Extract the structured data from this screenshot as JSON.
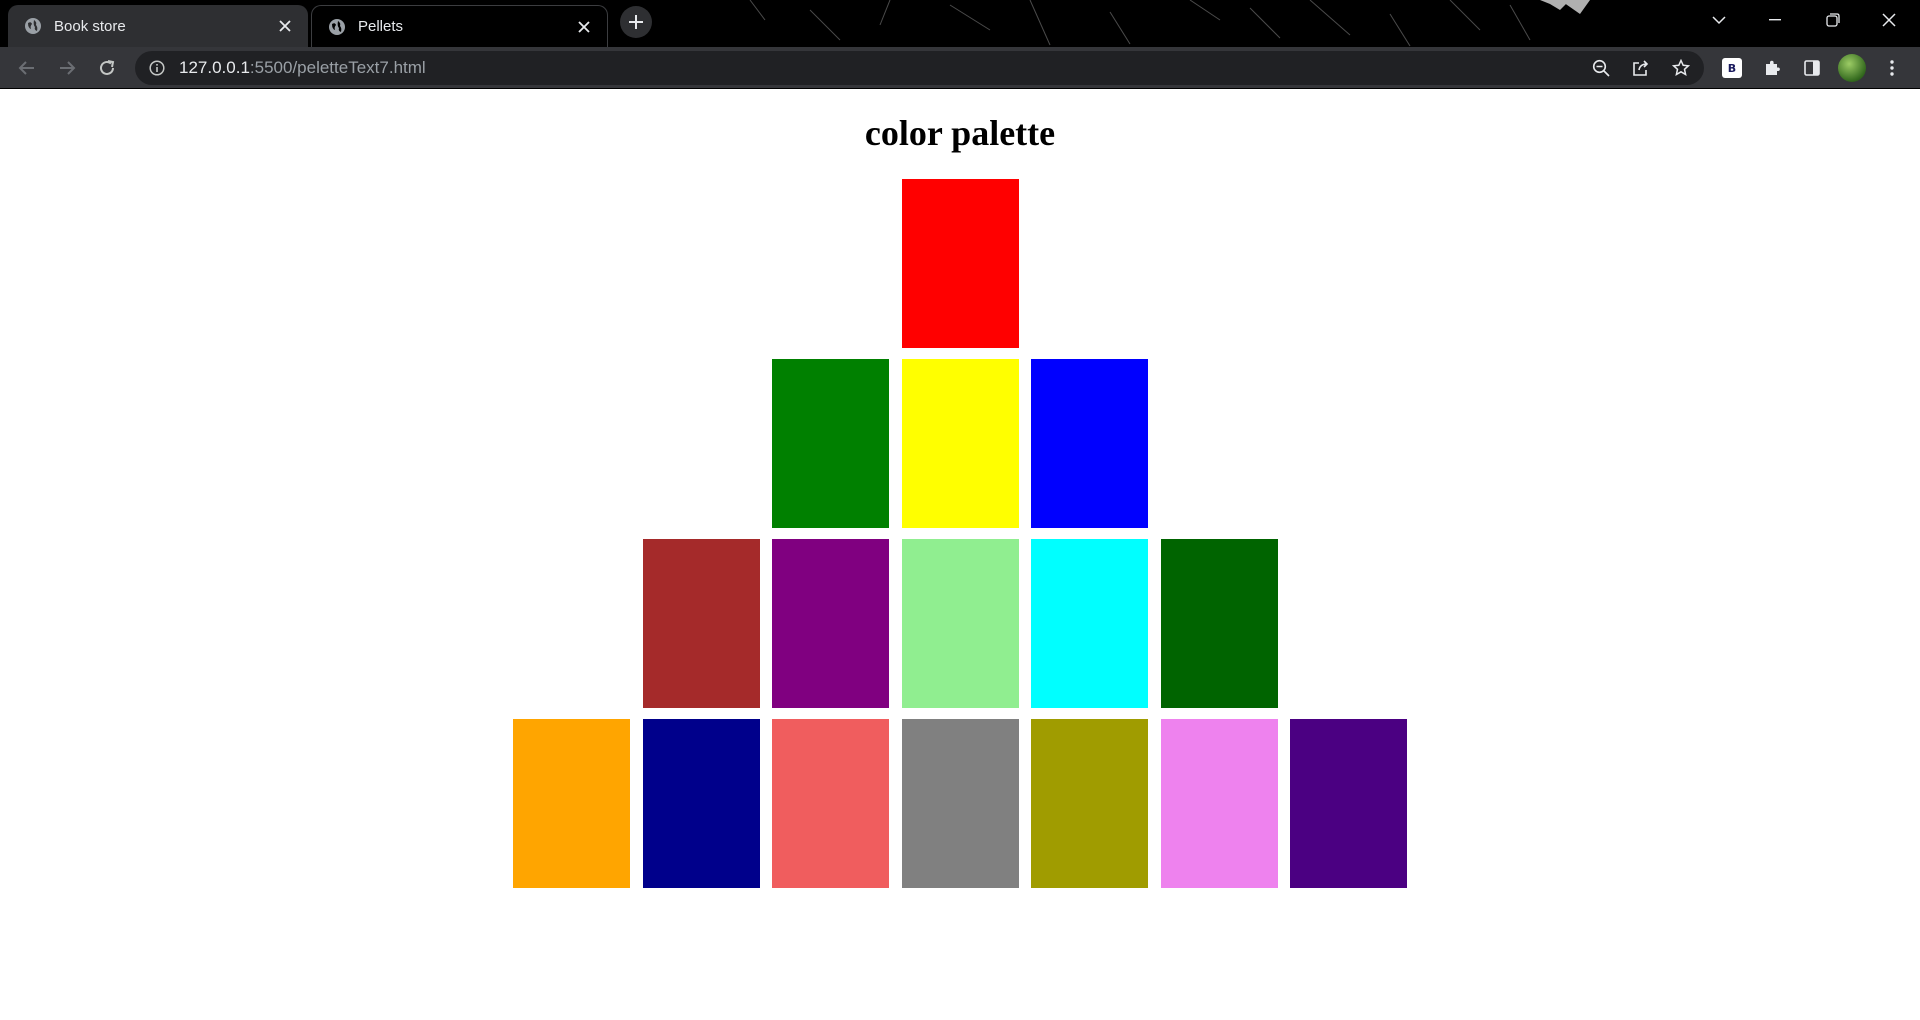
{
  "browser": {
    "tabs": [
      {
        "title": "Book store",
        "active": false
      },
      {
        "title": "Pellets",
        "active": true
      }
    ],
    "address": {
      "host": "127.0.0.1",
      "rest": ":5500/peletteText7.html"
    },
    "extension_badge": "B"
  },
  "page": {
    "title": "color palette"
  },
  "palette": {
    "rows": [
      [
        "#ff0000"
      ],
      [
        "#008000",
        "#ffff00",
        "#0000ff"
      ],
      [
        "#a52a2a",
        "#800080",
        "#90ee90",
        "#00ffff",
        "#006400"
      ],
      [
        "#ffa500",
        "#00008b",
        "#f05d5e",
        "#808080",
        "#a09c00",
        "#ee82ee",
        "#4b0082"
      ]
    ]
  }
}
